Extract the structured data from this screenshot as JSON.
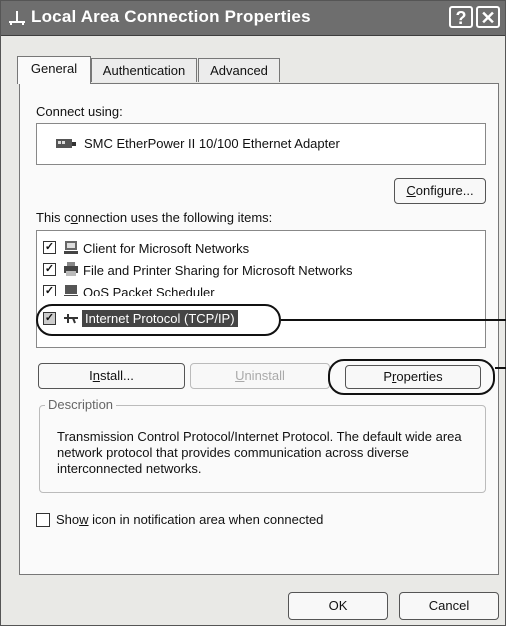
{
  "window": {
    "title": "Local Area Connection Properties",
    "help_label": "?",
    "close_label": "✕"
  },
  "tabs": [
    {
      "label": "General"
    },
    {
      "label": "Authentication"
    },
    {
      "label": "Advanced"
    }
  ],
  "connect_using": {
    "label": "Connect using:",
    "adapter": "SMC EtherPower II 10/100 Ethernet Adapter"
  },
  "configure_button": {
    "label_before": "",
    "accel": "C",
    "label_after": "onfigure..."
  },
  "items_label": {
    "before": "This c",
    "accel": "o",
    "after": "nnection uses the following items:"
  },
  "items": [
    {
      "label": "Client for Microsoft Networks",
      "checked": true,
      "icon": "network-client-icon"
    },
    {
      "label": "File and Printer Sharing for Microsoft Networks",
      "checked": true,
      "icon": "printer-sharing-icon"
    },
    {
      "label": "QoS Packet Scheduler",
      "checked": true,
      "icon": "qos-scheduler-icon"
    },
    {
      "label": "Internet Protocol (TCP/IP)",
      "checked": true,
      "icon": "protocol-icon",
      "selected": true
    }
  ],
  "buttons": {
    "install": {
      "before": "I",
      "accel": "n",
      "after": "stall..."
    },
    "uninstall": {
      "before": "",
      "accel": "U",
      "after": "ninstall"
    },
    "properties": {
      "before": "P",
      "accel": "r",
      "after": "operties"
    }
  },
  "description": {
    "legend": "Description",
    "text": "Transmission Control Protocol/Internet Protocol. The default wide area network protocol that provides communication across diverse interconnected networks."
  },
  "show_icon": {
    "before": "Sho",
    "accel": "w",
    "after": " icon in notification area when connected",
    "checked": false
  },
  "footer": {
    "ok": "OK",
    "cancel": "Cancel"
  }
}
